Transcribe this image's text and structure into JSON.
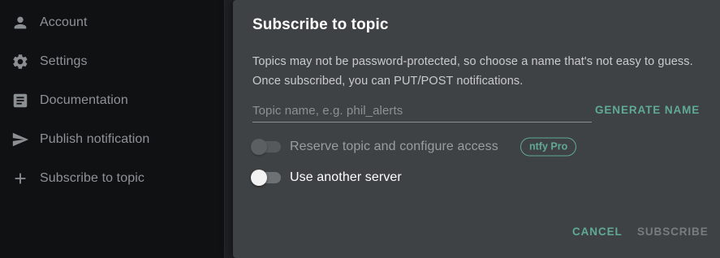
{
  "sidebar": {
    "items": [
      {
        "label": "Account",
        "icon": "person-icon"
      },
      {
        "label": "Settings",
        "icon": "gear-icon"
      },
      {
        "label": "Documentation",
        "icon": "article-icon"
      },
      {
        "label": "Publish notification",
        "icon": "send-icon"
      },
      {
        "label": "Subscribe to topic",
        "icon": "plus-icon"
      }
    ]
  },
  "dialog": {
    "title": "Subscribe to topic",
    "description": "Topics may not be password-protected, so choose a name that's not easy to guess. Once subscribed, you can PUT/POST notifications.",
    "topic_input": {
      "value": "",
      "placeholder": "Topic name, e.g. phil_alerts"
    },
    "generate_label": "Generate name",
    "reserve_toggle": {
      "label": "Reserve topic and configure access",
      "on": false,
      "disabled": true,
      "badge": "ntfy Pro"
    },
    "server_toggle": {
      "label": "Use another server",
      "on": false,
      "disabled": false
    },
    "cancel_label": "Cancel",
    "subscribe_label": "Subscribe"
  },
  "colors": {
    "accent": "#5fa995",
    "dialog_bg": "#3f4244",
    "sidebar_bg": "#0f1112"
  }
}
